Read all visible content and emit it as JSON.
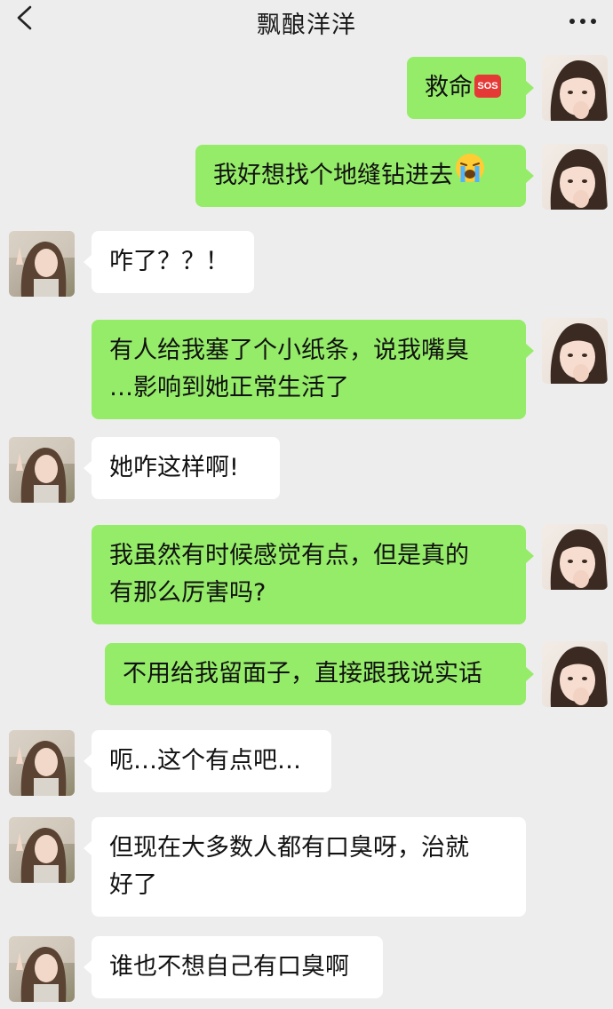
{
  "header": {
    "title": "飘酿洋洋",
    "back_icon": "chevron-left-icon",
    "more_icon": "more-dots-icon"
  },
  "colors": {
    "background": "#ededed",
    "my_bubble": "#95ec69",
    "their_bubble": "#ffffff",
    "sos_badge": "#e53935"
  },
  "messages": [
    {
      "from": "me",
      "lines": [
        "救命"
      ],
      "emoji": "sos-emoji",
      "emoji_text": "SOS"
    },
    {
      "from": "me",
      "lines": [
        "我好想找个地缝钻进去"
      ],
      "emoji": "crying-face-emoji"
    },
    {
      "from": "other",
      "lines": [
        "咋了？？！"
      ]
    },
    {
      "from": "me",
      "lines": [
        "有人给我塞了个小纸条，说我嘴臭",
        "…影响到她正常生活了"
      ]
    },
    {
      "from": "other",
      "lines": [
        "她咋这样啊!"
      ]
    },
    {
      "from": "me",
      "lines": [
        "我虽然有时候感觉有点，但是真的",
        "有那么厉害吗?"
      ]
    },
    {
      "from": "me",
      "lines": [
        "不用给我留面子，直接跟我说实话"
      ]
    },
    {
      "from": "other",
      "lines": [
        "呃…这个有点吧…"
      ]
    },
    {
      "from": "other",
      "lines": [
        "但现在大多数人都有口臭呀，治就",
        "好了"
      ]
    },
    {
      "from": "other",
      "lines": [
        "谁也不想自己有口臭啊"
      ]
    }
  ]
}
